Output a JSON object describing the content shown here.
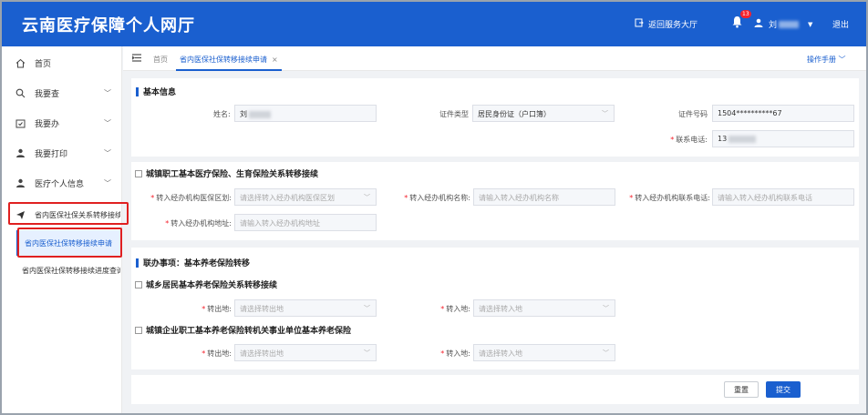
{
  "header": {
    "title": "云南医疗保障个人网厅",
    "return_label": "返回服务大厅",
    "notification_count": "13",
    "user_name": "刘",
    "logout_label": "退出"
  },
  "sidebar": {
    "items": [
      {
        "label": "首页",
        "icon": "home-icon"
      },
      {
        "label": "我要查",
        "icon": "search-icon"
      },
      {
        "label": "我要办",
        "icon": "handle-icon"
      },
      {
        "label": "我要打印",
        "icon": "printer-icon"
      },
      {
        "label": "医疗个人信息",
        "icon": "person-icon"
      },
      {
        "label": "省内医保社保关系转移接续",
        "icon": "send-icon"
      }
    ],
    "sub_items": [
      {
        "label": "省内医保社保转移接续申请"
      },
      {
        "label": "省内医保社保转移接续进度查询"
      }
    ]
  },
  "tabs": {
    "home_label": "首页",
    "active_label": "省内医保社保转移接续申请",
    "manual_label": "操作手册"
  },
  "basic": {
    "title": "基本信息",
    "name_label": "姓名:",
    "name_value": "刘",
    "idtype_label": "证件类型",
    "idtype_value": "居民身份证（户口簿）",
    "idno_label": "证件号码",
    "idno_value": "1504**********67",
    "phone_label": "联系电话:",
    "phone_value": "13"
  },
  "employee": {
    "title": "城镇职工基本医疗保险、生育保险关系转移接续",
    "agency_area_label": "转入经办机构医保区划:",
    "agency_area_placeholder": "请选择转入经办机构医保区划",
    "agency_name_label": "转入经办机构名称:",
    "agency_name_placeholder": "请输入转入经办机构名称",
    "agency_phone_label": "转入经办机构联系电话:",
    "agency_phone_placeholder": "请输入转入经办机构联系电话",
    "agency_addr_label": "转入经办机构地址:",
    "agency_addr_placeholder": "请输入转入经办机构地址"
  },
  "linked": {
    "title": "联办事项：基本养老保险转移",
    "group1_title": "城乡居民基本养老保险关系转移接续",
    "group2_title": "城镇企业职工基本养老保险转机关事业单位基本养老保险",
    "out_label": "转出地:",
    "out_placeholder": "请选择转出地",
    "in_label": "转入地:",
    "in_placeholder": "请选择转入地"
  },
  "actions": {
    "reset_label": "重置",
    "submit_label": "提交"
  },
  "colors": {
    "primary": "#1a5fcf",
    "highlight_box": "#e02020"
  }
}
